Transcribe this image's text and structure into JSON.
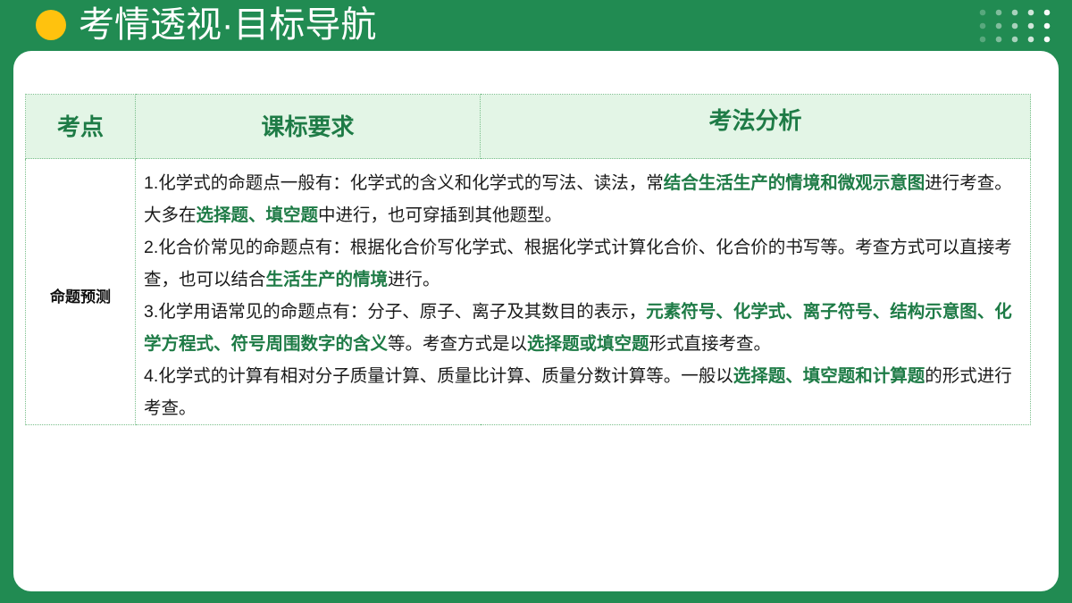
{
  "title": "考情透视·目标导航",
  "colors": {
    "background": "#218B52",
    "title_dot": "#FFC20E",
    "header_background": "#E3F5E6",
    "highlight_text": "#1E7B46",
    "table_border": "#79BE8A"
  },
  "table": {
    "headers": {
      "topic": "考点",
      "standards": "课标要求",
      "analysis": "考法分析"
    },
    "row": {
      "topic": "命题预测",
      "items": [
        [
          {
            "text": "1.化学式的命题点一般有：化学式的含义和化学式的写法、读法，常",
            "highlight": false
          },
          {
            "text": "结合生活生产的情境和微观示意图",
            "highlight": true
          },
          {
            "text": "进行考查。大多在",
            "highlight": false
          },
          {
            "text": "选择题、填空题",
            "highlight": true
          },
          {
            "text": "中进行，也可穿插到其他题型。",
            "highlight": false
          }
        ],
        [
          {
            "text": "2.化合价常见的命题点有：根据化合价写化学式、根据化学式计算化合价、化合价的书写等。考查方式可以直接考查，也可以结合",
            "highlight": false
          },
          {
            "text": "生活生产的情境",
            "highlight": true
          },
          {
            "text": "进行。",
            "highlight": false
          }
        ],
        [
          {
            "text": "3.化学用语常见的命题点有：分子、原子、离子及其数目的表示，",
            "highlight": false
          },
          {
            "text": "元素符号、化学式、离子符号、结构示意图、化学方程式、符号周围数字的含义",
            "highlight": true
          },
          {
            "text": "等。考查方式是以",
            "highlight": false
          },
          {
            "text": "选择题或填空题",
            "highlight": true
          },
          {
            "text": "形式直接考查。",
            "highlight": false
          }
        ],
        [
          {
            "text": "4.化学式的计算有相对分子质量计算、质量比计算、质量分数计算等。一般以",
            "highlight": false
          },
          {
            "text": "选择题、填空题和计算题",
            "highlight": true
          },
          {
            "text": "的形式进行考查。",
            "highlight": false
          }
        ]
      ]
    }
  }
}
